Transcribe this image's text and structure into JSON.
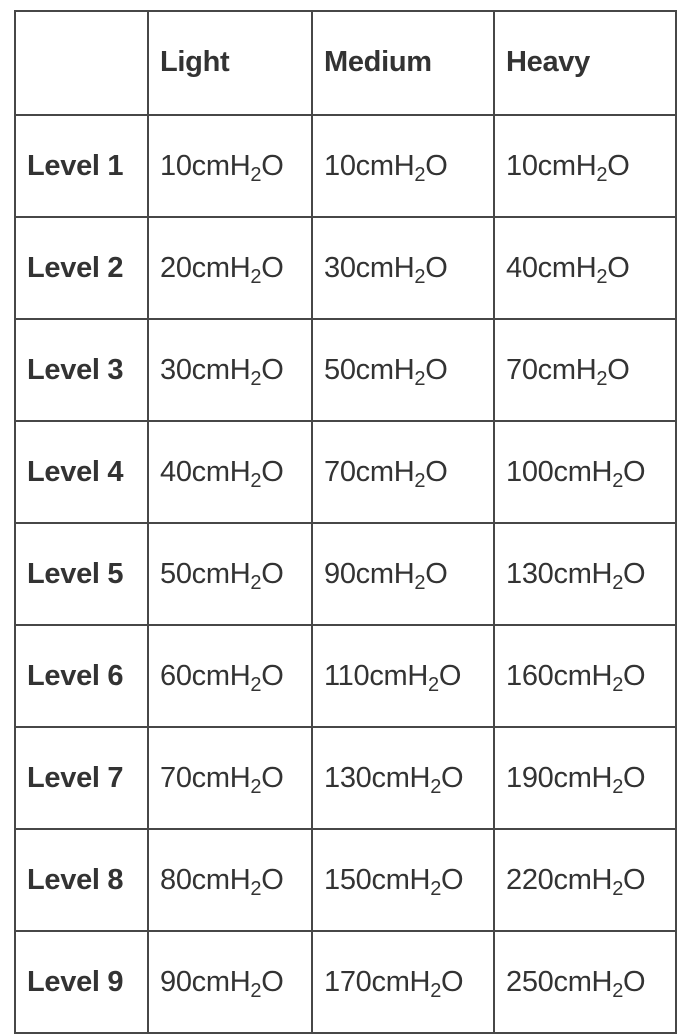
{
  "table": {
    "corner": "",
    "columns": [
      "Light",
      "Medium",
      "Heavy"
    ],
    "unit": {
      "prefix": "cmH",
      "subscript": "2",
      "suffix": "O"
    },
    "rows": [
      {
        "label": "Level 1",
        "values": [
          "10",
          "10",
          "10"
        ]
      },
      {
        "label": "Level 2",
        "values": [
          "20",
          "30",
          "40"
        ]
      },
      {
        "label": "Level 3",
        "values": [
          "30",
          "50",
          "70"
        ]
      },
      {
        "label": "Level 4",
        "values": [
          "40",
          "70",
          "100"
        ]
      },
      {
        "label": "Level 5",
        "values": [
          "50",
          "90",
          "130"
        ]
      },
      {
        "label": "Level 6",
        "values": [
          "60",
          "110",
          "160"
        ]
      },
      {
        "label": "Level 7",
        "values": [
          "70",
          "130",
          "190"
        ]
      },
      {
        "label": "Level 8",
        "values": [
          "80",
          "150",
          "220"
        ]
      },
      {
        "label": "Level 9",
        "values": [
          "90",
          "170",
          "250"
        ]
      }
    ]
  }
}
